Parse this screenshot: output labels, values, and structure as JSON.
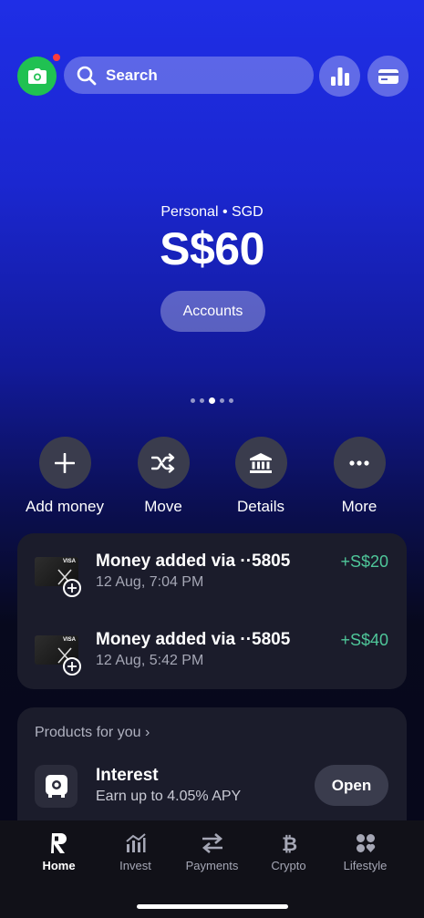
{
  "header": {
    "search_placeholder": "Search",
    "camera_icon": "camera-icon",
    "analytics_icon": "bar-chart-icon",
    "cards_icon": "card-icon",
    "notification_dot_color": "#ff3b3b"
  },
  "balance": {
    "label": "Personal • SGD",
    "amount": "S$60",
    "accounts_button": "Accounts"
  },
  "carousel": {
    "count": 5,
    "active_index": 2
  },
  "actions": [
    {
      "label": "Add money",
      "icon": "plus-icon"
    },
    {
      "label": "Move",
      "icon": "shuffle-icon"
    },
    {
      "label": "Details",
      "icon": "bank-icon"
    },
    {
      "label": "More",
      "icon": "more-icon"
    }
  ],
  "transactions": [
    {
      "title": "Money added via ··5805",
      "date": "12 Aug, 7:04 PM",
      "amount": "+S$20"
    },
    {
      "title": "Money added via ··5805",
      "date": "12 Aug, 5:42 PM",
      "amount": "+S$40"
    }
  ],
  "products": {
    "header": "Products for you ›",
    "item_title": "Interest",
    "item_subtitle": "Earn up to 4.05% APY",
    "open_button": "Open"
  },
  "bottom_nav": [
    {
      "label": "Home",
      "icon": "revolut-r-icon",
      "active": true
    },
    {
      "label": "Invest",
      "icon": "invest-chart-icon"
    },
    {
      "label": "Payments",
      "icon": "transfer-arrows-icon"
    },
    {
      "label": "Crypto",
      "icon": "bitcoin-icon"
    },
    {
      "label": "Lifestyle",
      "icon": "lifestyle-icon"
    }
  ],
  "colors": {
    "accent_green": "#20c152",
    "amount_positive": "#4fc79a",
    "card_bg": "#1b1c2b"
  }
}
